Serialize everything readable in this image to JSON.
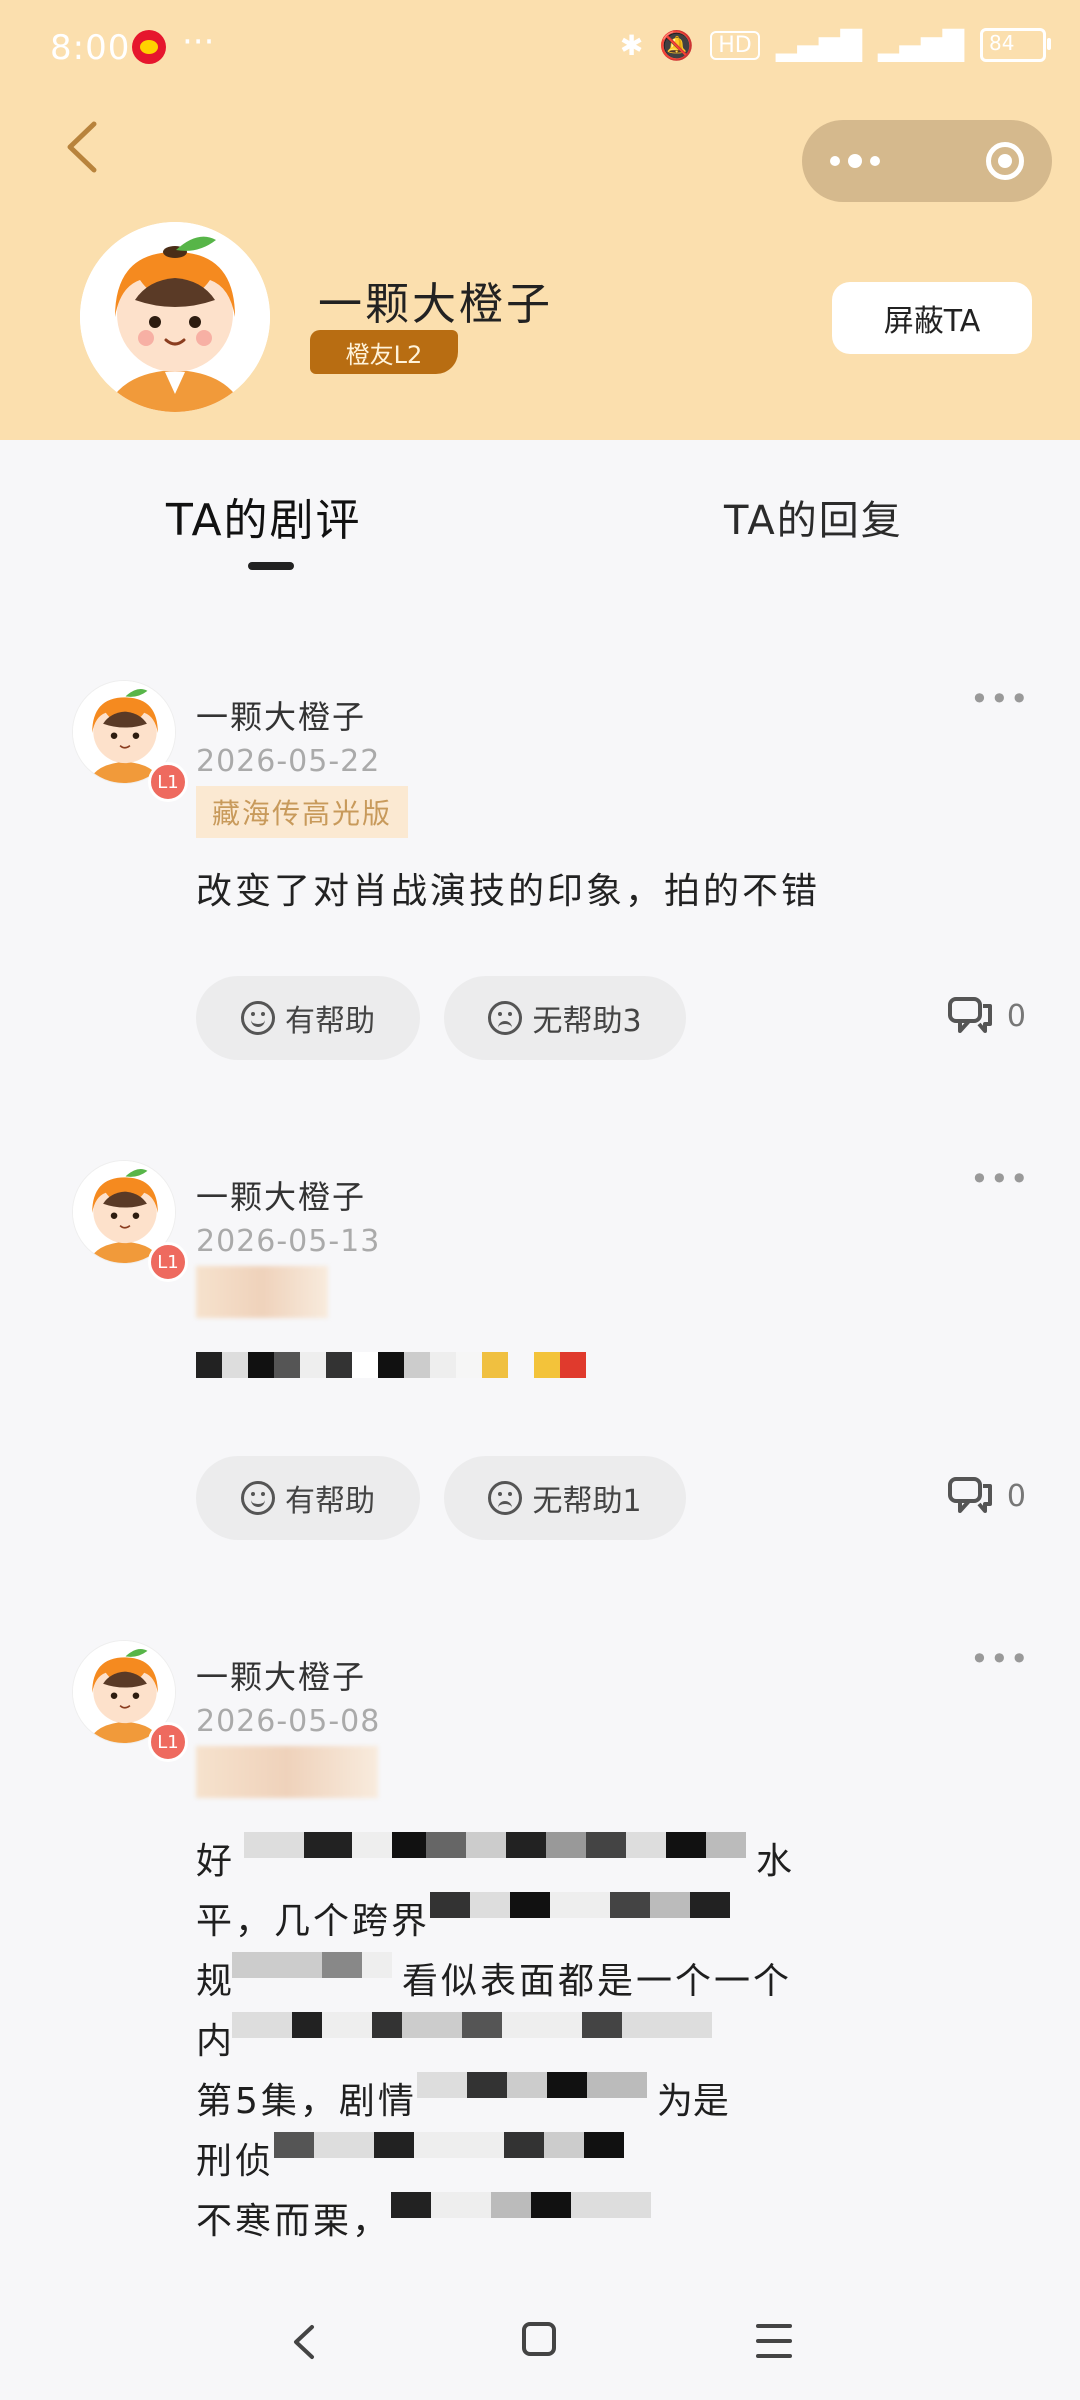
{
  "status_bar": {
    "time": "8:00",
    "dots": "···",
    "battery": "84",
    "hd": "HD"
  },
  "header": {
    "username": "一颗大橙子",
    "level": "橙友L2",
    "block_button": "屏蔽TA"
  },
  "tabs": [
    {
      "label": "TA的剧评",
      "active": true
    },
    {
      "label": "TA的回复",
      "active": false
    }
  ],
  "reviews": [
    {
      "author": "一颗大橙子",
      "level": "L1",
      "date": "2026-05-22",
      "tag": "藏海传高光版",
      "text": "改变了对肖战演技的印象，拍的不错",
      "helpful": "有帮助",
      "unhelpful": "无帮助3",
      "comments": "0"
    },
    {
      "author": "一颗大橙子",
      "level": "L1",
      "date": "2026-05-13",
      "tag": "",
      "text": "",
      "helpful": "有帮助",
      "unhelpful": "无帮助1",
      "comments": "0"
    },
    {
      "author": "一颗大橙子",
      "level": "L1",
      "date": "2026-05-08",
      "tag": "",
      "text": "",
      "visible_fragments": [
        "好",
        "水",
        "平，几个跨界",
        "规",
        "看似表面都是一个一个",
        "内",
        "第5集，剧情",
        "为是",
        "刑侦",
        "不寒而栗，"
      ]
    }
  ],
  "colors": {
    "header_bg": "#fbdfae",
    "level_badge": "#b86d12",
    "page_bg": "#f7f7f9",
    "tag_bg": "#fbe9d2",
    "tag_text": "#c89a5b",
    "l1_badge": "#ee6a5f"
  },
  "icons": [
    "back-arrow-icon",
    "more-dots-icon",
    "mini-program-close-icon",
    "smile-icon",
    "frown-icon",
    "comment-icon",
    "nav-back-icon",
    "nav-home-icon",
    "nav-menu-icon"
  ]
}
